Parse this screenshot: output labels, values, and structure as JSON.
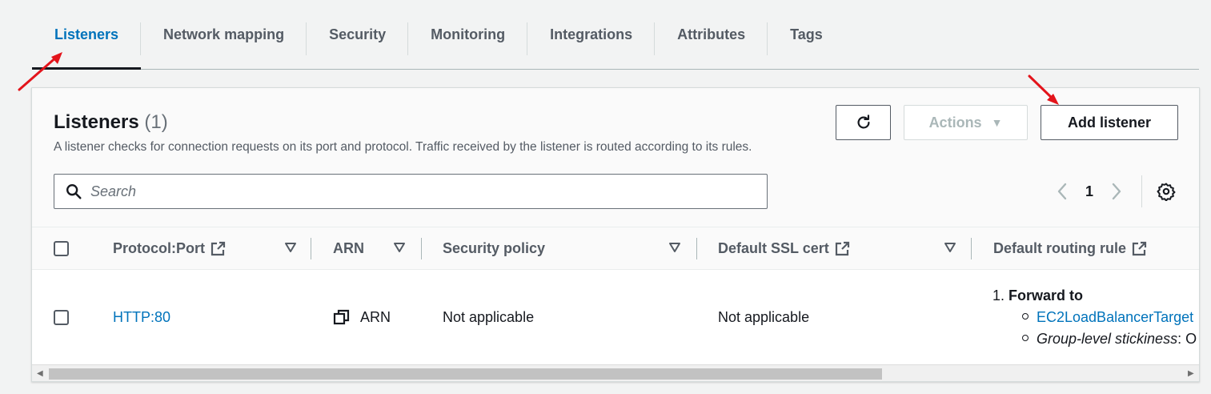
{
  "tabs": [
    {
      "label": "Listeners",
      "active": true
    },
    {
      "label": "Network mapping",
      "active": false
    },
    {
      "label": "Security",
      "active": false
    },
    {
      "label": "Monitoring",
      "active": false
    },
    {
      "label": "Integrations",
      "active": false
    },
    {
      "label": "Attributes",
      "active": false
    },
    {
      "label": "Tags",
      "active": false
    }
  ],
  "panel": {
    "title": "Listeners",
    "count": "(1)",
    "description": "A listener checks for connection requests on its port and protocol. Traffic received by the listener is routed according to its rules.",
    "actions_label": "Actions",
    "add_label": "Add listener",
    "search_placeholder": "Search",
    "page_number": "1"
  },
  "table": {
    "columns": {
      "protocol_port": "Protocol:Port",
      "arn": "ARN",
      "security_policy": "Security policy",
      "ssl_cert": "Default SSL cert",
      "routing_rule": "Default routing rule"
    },
    "rows": [
      {
        "protocol_port": "HTTP:80",
        "arn": "ARN",
        "security_policy": "Not applicable",
        "ssl_cert": "Not applicable",
        "routing": {
          "index": "1.",
          "action": "Forward to",
          "target": "EC2LoadBalancerTarget",
          "stickiness_label": "Group-level stickiness",
          "stickiness_value": ": O"
        }
      }
    ]
  },
  "colors": {
    "accent": "#0073bb",
    "annotation_arrow": "#e3141b"
  }
}
